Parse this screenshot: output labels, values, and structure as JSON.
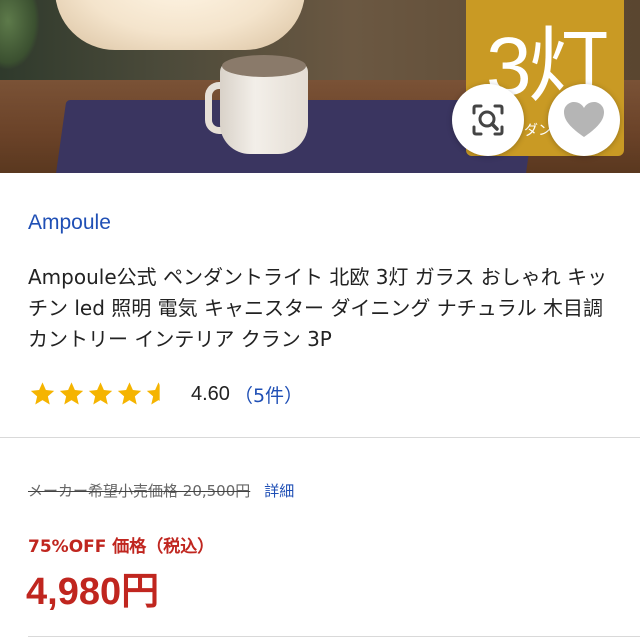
{
  "hero": {
    "badge_text": "3灯",
    "badge_subtext": "ダン"
  },
  "actions": {
    "lens_icon": "image-search-icon",
    "favorite_icon": "heart-icon"
  },
  "product": {
    "brand": "Ampoule",
    "title": "Ampoule公式 ペンダントライト 北欧 3灯 ガラス おしゃれ キッチン led 照明 電気 キャニスター ダイニング ナチュラル 木目調 カントリー インテリア クラン 3P",
    "rating": {
      "stars": 4.6,
      "value_text": "4.60",
      "count_text": "（5件）"
    },
    "list_price_text": "メーカー希望小売価格 20,500円",
    "detail_link": "詳細",
    "discount_label": "75%OFF 価格（税込）",
    "price": "4,980円"
  },
  "colors": {
    "accent_blue": "#1f4fb5",
    "price_red": "#c0261f",
    "star_gold": "#f5b400",
    "badge_gold": "#c99a24"
  }
}
